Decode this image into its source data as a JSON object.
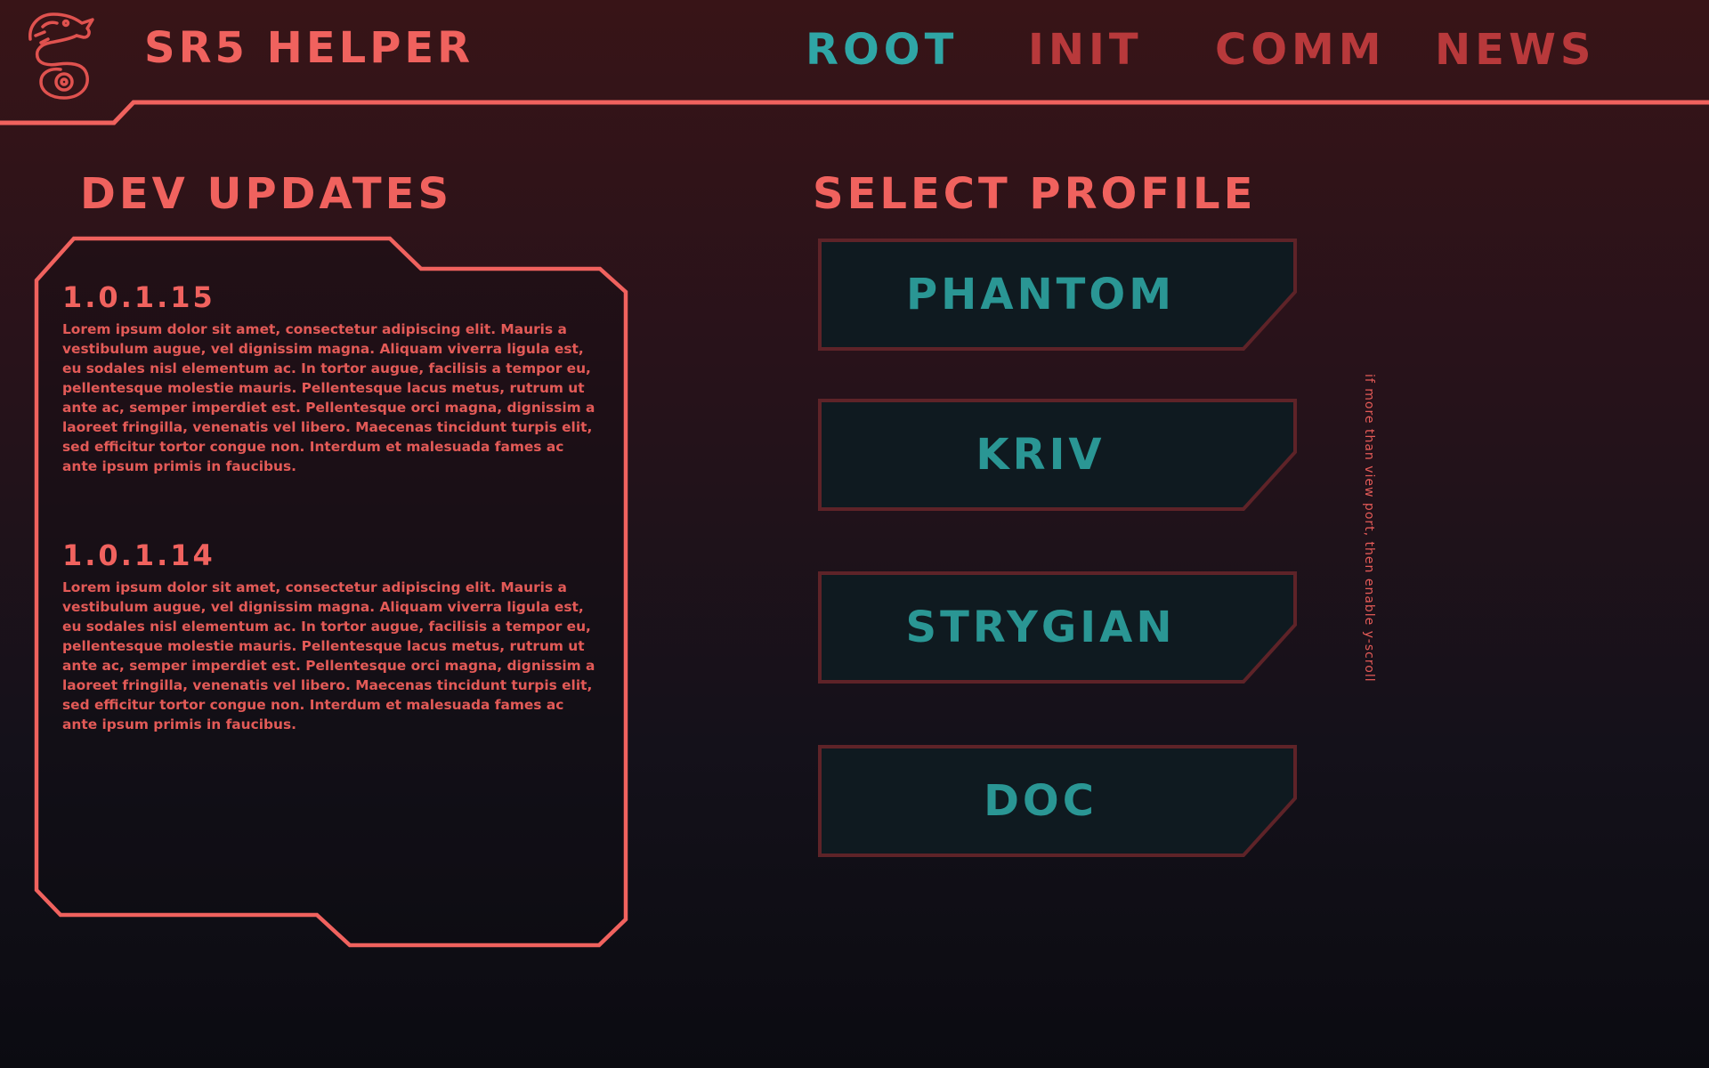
{
  "app": {
    "title": "SR5 HELPER",
    "logo_icon": "dragon-emblem-icon"
  },
  "nav": {
    "items": [
      {
        "label": "ROOT",
        "active": true
      },
      {
        "label": "INIT",
        "active": false
      },
      {
        "label": "COMM",
        "active": false
      },
      {
        "label": "NEWS",
        "active": false
      }
    ]
  },
  "dev_updates": {
    "heading": "DEV UPDATES",
    "entries": [
      {
        "version": "1.0.1.15",
        "body": "Lorem ipsum dolor sit amet, consectetur adipiscing elit. Mauris a vestibulum augue, vel dignissim magna. Aliquam viverra ligula est, eu sodales nisl elementum ac. In tortor augue, facilisis a tempor eu, pellentesque molestie mauris. Pellentesque lacus metus, rutrum ut ante ac, semper imperdiet est. Pellentesque orci magna, dignissim a laoreet fringilla, venenatis vel libero. Maecenas tincidunt turpis elit, sed efficitur tortor congue non. Interdum et malesuada fames ac ante ipsum primis in faucibus."
      },
      {
        "version": "1.0.1.14",
        "body": "Lorem ipsum dolor sit amet, consectetur adipiscing elit. Mauris a vestibulum augue, vel dignissim magna. Aliquam viverra ligula est, eu sodales nisl elementum ac. In tortor augue, facilisis a tempor eu, pellentesque molestie mauris. Pellentesque lacus metus, rutrum ut ante ac, semper imperdiet est. Pellentesque orci magna, dignissim a laoreet fringilla, venenatis vel libero. Maecenas tincidunt turpis elit, sed efficitur tortor congue non. Interdum et malesuada fames ac ante ipsum primis in faucibus."
      }
    ]
  },
  "profiles": {
    "heading": "SELECT PROFILE",
    "items": [
      {
        "label": "PHANTOM"
      },
      {
        "label": "KRIV"
      },
      {
        "label": "STRYGIAN"
      },
      {
        "label": "DOC"
      }
    ]
  },
  "annotation": {
    "scroll_note": "if more than view port, then enable y-scroll"
  },
  "colors": {
    "accent": "#f0625e",
    "nav_inactive": "#b8393b",
    "teal": "#2fa6a6",
    "button_fill": "#0f1a20",
    "button_border": "#5e2328"
  }
}
